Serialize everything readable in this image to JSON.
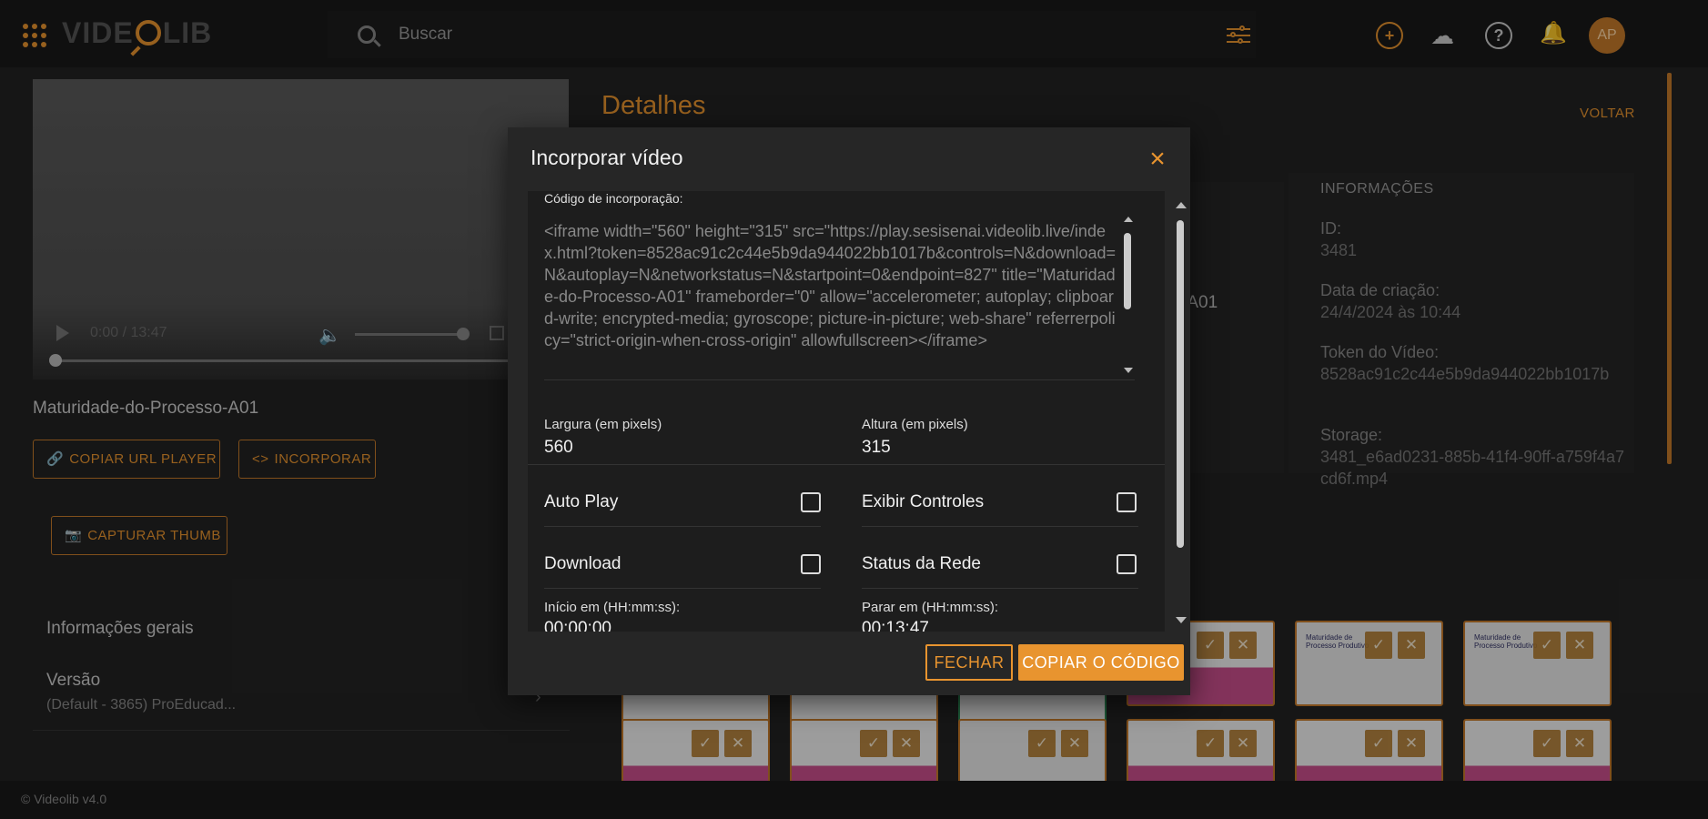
{
  "header": {
    "logo": "VIDEOLIB",
    "search": {
      "placeholder": "Buscar"
    },
    "avatar_initials": "AP",
    "icons": [
      "apps-grid-icon",
      "search-icon",
      "filter-sliders-icon",
      "add-circle-icon",
      "cloud-upload-icon",
      "help-icon",
      "bell-icon"
    ]
  },
  "player": {
    "time": "0:00 / 13:47",
    "progress": 0
  },
  "left": {
    "video_title": "Maturidade-do-Processo-A01",
    "copy_url_label": "COPIAR URL PLAYER",
    "embed_label": "INCORPORAR",
    "capture_thumb_label": "CAPTURAR THUMB",
    "general_info_label": "Informações gerais",
    "version_label": "Versão",
    "version_value": "(Default - 3865) ProEducad..."
  },
  "details": {
    "title": "Detalhes",
    "back_label": "VOLTAR",
    "title_tail": "-A01",
    "info": {
      "heading": "INFORMAÇÕES",
      "id_label": "ID:",
      "id_value": "3481",
      "created_label": "Data de criação:",
      "created_value": "24/4/2024 às 10:44",
      "token_label": "Token do Vídeo:",
      "token_value": "8528ac91c2c44e5b9da944022bb1017b",
      "storage_label": "Storage:",
      "storage_value": "3481_e6ad0231-885b-41f4-90ff-a759f4a7cd6f.mp4"
    },
    "thumb_title": "Maturidade de Processo Produtivo"
  },
  "modal": {
    "title": "Incorporar vídeo",
    "code_label": "Código de incorporação:",
    "code": "<iframe width=\"560\" height=\"315\" src=\"https://play.sesisenai.videolib.live/index.html?token=8528ac91c2c44e5b9da944022bb1017b&controls=N&download=N&autoplay=N&networkstatus=N&startpoint=0&endpoint=827\" title=\"Maturidade-do-Processo-A01\" frameborder=\"0\" allow=\"accelerometer; autoplay; clipboard-write; encrypted-media; gyroscope; picture-in-picture; web-share\" referrerpolicy=\"strict-origin-when-cross-origin\" allowfullscreen></iframe>",
    "width_label": "Largura (em pixels)",
    "width_value": "560",
    "height_label": "Altura (em pixels)",
    "height_value": "315",
    "autoplay_label": "Auto Play",
    "controls_label": "Exibir Controles",
    "download_label": "Download",
    "network_label": "Status da Rede",
    "start_label": "Início em (HH:mm:ss):",
    "start_value": "00:00:00",
    "end_label": "Parar em (HH:mm:ss):",
    "end_value": "00:13:47",
    "close_label": "FECHAR",
    "copy_label": "COPIAR O CÓDIGO"
  },
  "footer": {
    "text": "© Videolib v4.0"
  },
  "colors": {
    "accent": "#e8942f",
    "background": "#232323",
    "modal": "#262626"
  }
}
